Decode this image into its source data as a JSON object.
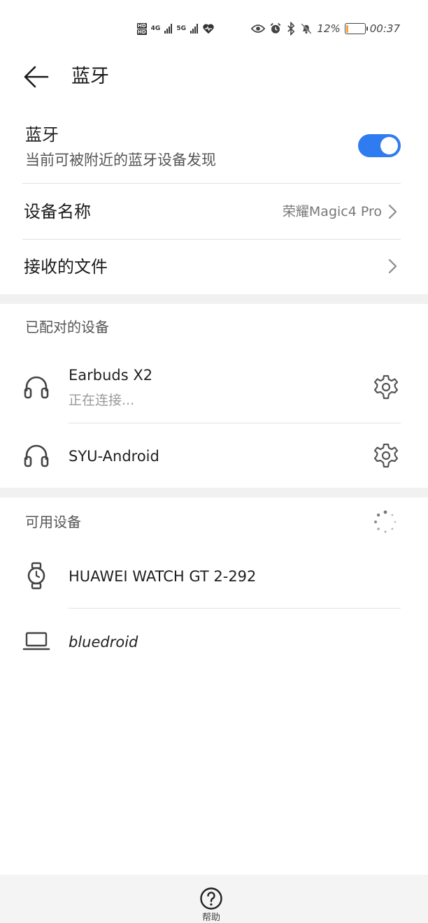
{
  "status_bar": {
    "left_labels": [
      "HD",
      "4G",
      "5G"
    ],
    "battery_percent": "12%",
    "battery_level": 0.12,
    "time": "00:37",
    "icons": [
      "eye-icon",
      "alarm-icon",
      "bluetooth-icon",
      "mute-icon"
    ],
    "battery_color": "#f2a33a"
  },
  "header": {
    "title": "蓝牙"
  },
  "bluetooth": {
    "label": "蓝牙",
    "subtitle": "当前可被附近的蓝牙设备发现",
    "enabled": true,
    "toggle_color": "#2f7bf0"
  },
  "device_name": {
    "label": "设备名称",
    "value": "荣耀Magic4 Pro"
  },
  "received_files": {
    "label": "接收的文件"
  },
  "paired": {
    "title": "已配对的设备",
    "devices": [
      {
        "name": "Earbuds X2",
        "status": "正在连接...",
        "icon": "headset-icon"
      },
      {
        "name": "SYU-Android",
        "status": "",
        "icon": "headset-icon"
      }
    ]
  },
  "available": {
    "title": "可用设备",
    "devices": [
      {
        "name": "HUAWEI WATCH GT 2-292",
        "icon": "watch-icon"
      },
      {
        "name": "bluedroid",
        "icon": "laptop-icon"
      }
    ]
  },
  "bottom": {
    "help_label": "帮助"
  }
}
